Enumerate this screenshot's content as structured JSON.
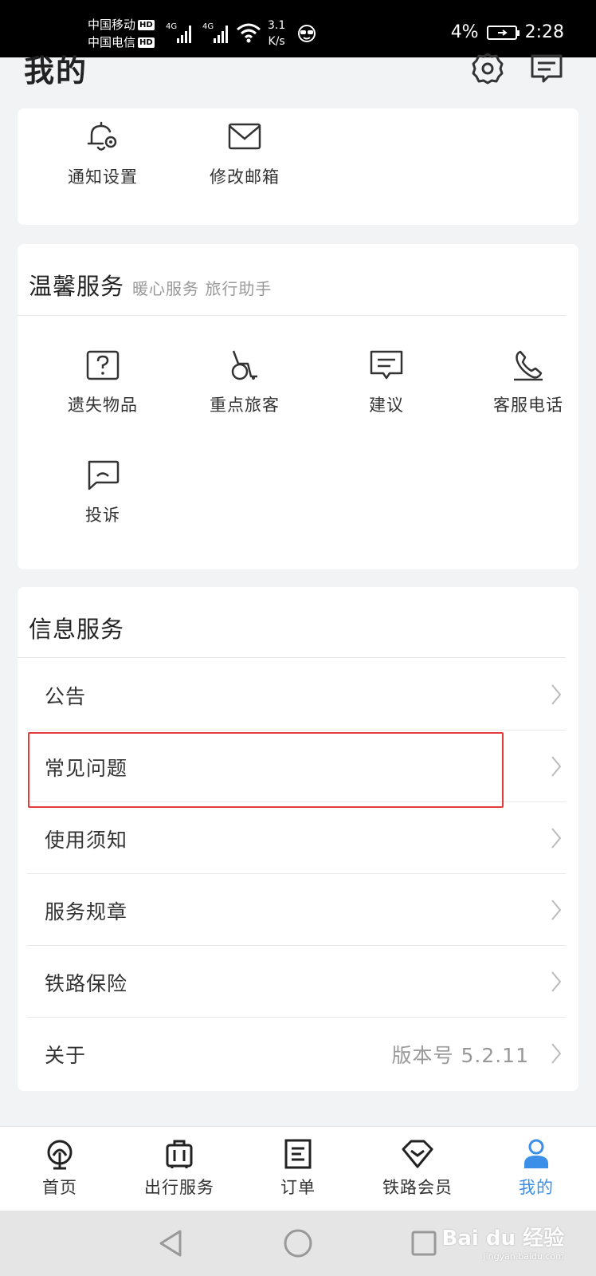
{
  "status_bar": {
    "carrier1": "中国移动",
    "carrier2": "中国电信",
    "hd": "HD",
    "net1": "4G",
    "net2": "4G",
    "speed_value": "3.1",
    "speed_unit": "K/s",
    "battery": "4%",
    "time": "2:28"
  },
  "header": {
    "title": "我的",
    "settings_icon": "gear-icon",
    "message_icon": "message-icon"
  },
  "settings_card": {
    "items": [
      {
        "label": "通知设置",
        "icon": "bell-gear-icon"
      },
      {
        "label": "修改邮箱",
        "icon": "envelope-icon"
      }
    ]
  },
  "warm_service": {
    "title": "温馨服务",
    "subtitle": "暖心服务 旅行助手",
    "items": [
      {
        "label": "遗失物品",
        "icon": "question-box-icon"
      },
      {
        "label": "重点旅客",
        "icon": "wheelchair-icon"
      },
      {
        "label": "建议",
        "icon": "suggestion-icon"
      },
      {
        "label": "客服电话",
        "icon": "phone-icon"
      },
      {
        "label": "投诉",
        "icon": "complaint-icon"
      }
    ]
  },
  "info_service": {
    "title": "信息服务",
    "rows": [
      {
        "label": "公告"
      },
      {
        "label": "常见问题"
      },
      {
        "label": "使用须知"
      },
      {
        "label": "服务规章"
      },
      {
        "label": "铁路保险"
      },
      {
        "label": "关于",
        "value": "版本号 5.2.11"
      }
    ]
  },
  "tab_bar": {
    "active_color": "#3b8fe8",
    "tabs": [
      {
        "label": "首页",
        "icon": "railway-logo-icon"
      },
      {
        "label": "出行服务",
        "icon": "luggage-icon"
      },
      {
        "label": "订单",
        "icon": "order-icon"
      },
      {
        "label": "铁路会员",
        "icon": "diamond-icon"
      },
      {
        "label": "我的",
        "icon": "user-icon",
        "active": true
      }
    ]
  },
  "watermark": {
    "text": "Bai du 经验",
    "url": "jingyan.baidu.com"
  }
}
